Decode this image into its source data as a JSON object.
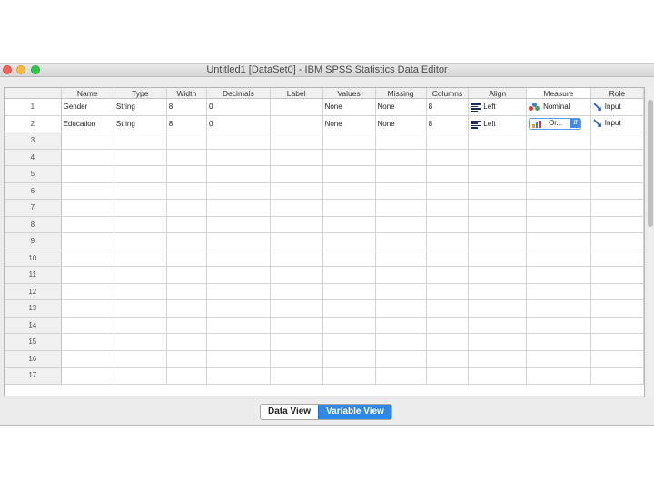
{
  "window": {
    "title": "Untitled1 [DataSet0] - IBM SPSS Statistics Data Editor"
  },
  "columns": [
    "Name",
    "Type",
    "Width",
    "Decimals",
    "Label",
    "Values",
    "Missing",
    "Columns",
    "Align",
    "Measure",
    "Role"
  ],
  "rows": [
    {
      "num": "1",
      "name": "Gender",
      "type": "String",
      "width": "8",
      "decimals": "0",
      "label": "",
      "values": "None",
      "missing": "None",
      "columns": "8",
      "align": "Left",
      "measure": "Nominal",
      "role": "Input"
    },
    {
      "num": "2",
      "name": "Education",
      "type": "String",
      "width": "8",
      "decimals": "0",
      "label": "",
      "values": "None",
      "missing": "None",
      "columns": "8",
      "align": "Left",
      "measure": "Or...",
      "role": "Input"
    }
  ],
  "empty_rows": [
    "3",
    "4",
    "5",
    "6",
    "7",
    "8",
    "9",
    "10",
    "11",
    "12",
    "13",
    "14",
    "15",
    "16",
    "17"
  ],
  "icons": {
    "align": "align-left-icon",
    "measure_nominal": "nominal-icon",
    "measure_ordinal": "ordinal-icon",
    "role": "input-arrow-icon",
    "dropdown": "chevron-updown-icon"
  },
  "tabs": {
    "data_view": "Data View",
    "variable_view": "Variable View"
  },
  "colors": {
    "accent": "#2f88e8",
    "close": "#fc605c",
    "minimize": "#fdbc40",
    "zoom": "#34c84a"
  }
}
